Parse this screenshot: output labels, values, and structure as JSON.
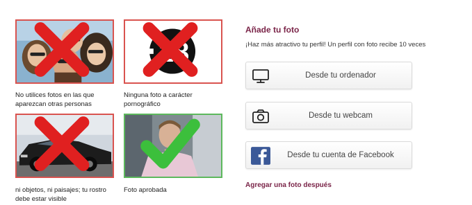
{
  "tiles": [
    {
      "caption": "No utilices fotos en las que aparezcan otras personas",
      "status": "rejected"
    },
    {
      "caption": "Ninguna foto a carácter pornográfico",
      "badge": "18",
      "status": "rejected"
    },
    {
      "caption": "ni objetos, ni paisajes; tu rostro debe estar visible",
      "status": "rejected"
    },
    {
      "caption": "Foto aprobada",
      "status": "approved"
    }
  ],
  "panel": {
    "title": "Añade tu foto",
    "subtitle": "¡Haz más atractivo tu perfil! Un perfil con foto recibe 10 veces",
    "options": [
      {
        "label": "Desde tu ordenador",
        "icon": "monitor-icon"
      },
      {
        "label": "Desde tu webcam",
        "icon": "camera-icon"
      },
      {
        "label": "Desde tu cuenta de Facebook",
        "icon": "facebook-icon"
      }
    ],
    "later_link": "Agregar una foto después"
  },
  "colors": {
    "accent": "#7a2448",
    "reject": "#d9534f",
    "approve": "#5cb85c",
    "facebook": "#3b5998"
  }
}
